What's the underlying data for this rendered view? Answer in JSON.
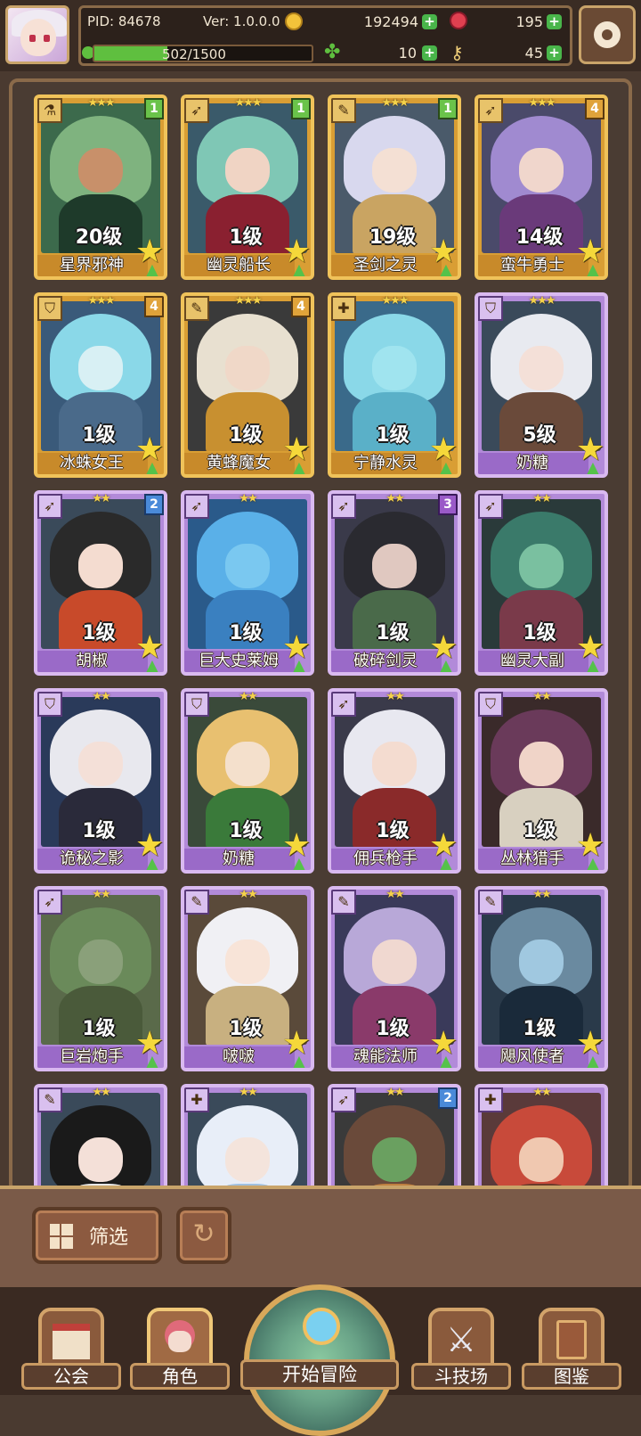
{
  "hud": {
    "pid": "PID: 84678",
    "version": "Ver: 1.0.0.0",
    "gold": "192494",
    "gems": "195",
    "stamina": "502/1500",
    "stamina_fraction": 0.335,
    "clover": "10",
    "key": "45",
    "colors": {
      "gold": "#f3c33a",
      "gem": "#e04050",
      "clover": "#5fbf3f",
      "key": "#f2d07a"
    }
  },
  "cards": [
    {
      "name": "星界邪神",
      "level": "20级",
      "rarity": "gold",
      "stars": "★★★",
      "badge": "1",
      "badge_color": "green",
      "role": "flask-icon",
      "palette": [
        "#3c6a4c",
        "#7fb37f",
        "#c8906a",
        "#1e3a2a"
      ]
    },
    {
      "name": "幽灵船长",
      "level": "1级",
      "rarity": "gold",
      "stars": "★★★",
      "badge": "1",
      "badge_color": "green",
      "role": "bow-icon",
      "palette": [
        "#3a5a6a",
        "#7fc7b5",
        "#f0d4c4",
        "#8a2030"
      ]
    },
    {
      "name": "圣剑之灵",
      "level": "19级",
      "rarity": "gold",
      "stars": "★★★",
      "badge": "1",
      "badge_color": "green",
      "role": "staff-icon",
      "palette": [
        "#4a5a6a",
        "#d8d8ee",
        "#f4e0d4",
        "#c9a462"
      ]
    },
    {
      "name": "蛮牛勇士",
      "level": "14级",
      "rarity": "gold",
      "stars": "★★★",
      "badge": "4",
      "badge_color": "gold",
      "role": "bow-icon",
      "palette": [
        "#4a4a6a",
        "#a08ad0",
        "#f0d6cc",
        "#6a3a7a"
      ]
    },
    {
      "name": "冰蛛女王",
      "level": "1级",
      "rarity": "gold",
      "stars": "★★★",
      "badge": "4",
      "badge_color": "gold",
      "role": "shield-icon",
      "palette": [
        "#3a5a7a",
        "#8ad8e8",
        "#d8f0f4",
        "#4a6a8a"
      ]
    },
    {
      "name": "黄蜂魔女",
      "level": "1级",
      "rarity": "gold",
      "stars": "★★★",
      "badge": "4",
      "badge_color": "gold",
      "role": "staff-icon",
      "palette": [
        "#3a3a3a",
        "#e8e0d0",
        "#f0d8c8",
        "#c89030"
      ]
    },
    {
      "name": "宁静水灵",
      "level": "1级",
      "rarity": "gold",
      "stars": "★★★",
      "badge": "",
      "badge_color": "",
      "role": "cross-icon",
      "palette": [
        "#3a6a8a",
        "#8ad8e8",
        "#a0e4ef",
        "#5ab0c8"
      ]
    },
    {
      "name": "奶糖",
      "level": "5级",
      "rarity": "purple",
      "stars": "★★★",
      "badge": "",
      "badge_color": "",
      "role": "shield-icon",
      "palette": [
        "#3a4a5a",
        "#e8eaf0",
        "#f4e0d8",
        "#6a4a3a"
      ]
    },
    {
      "name": "胡椒",
      "level": "1级",
      "rarity": "purple",
      "stars": "★★",
      "badge": "2",
      "badge_color": "blue",
      "role": "bow-icon",
      "palette": [
        "#3a4a5a",
        "#2a2a2a",
        "#f4dcd0",
        "#c84a2a"
      ]
    },
    {
      "name": "巨大史莱姆",
      "level": "1级",
      "rarity": "purple",
      "stars": "★★",
      "badge": "",
      "badge_color": "",
      "role": "bow-icon",
      "palette": [
        "#2a5a8a",
        "#5ab0e8",
        "#7ac8f0",
        "#3a80c0"
      ]
    },
    {
      "name": "破碎剑灵",
      "level": "1级",
      "rarity": "purple",
      "stars": "★★",
      "badge": "3",
      "badge_color": "purple",
      "role": "bow-icon",
      "palette": [
        "#3a3a4a",
        "#2a2a30",
        "#e0c8c0",
        "#4a6a4a"
      ]
    },
    {
      "name": "幽灵大副",
      "level": "1级",
      "rarity": "purple",
      "stars": "★★",
      "badge": "",
      "badge_color": "",
      "role": "bow-icon",
      "palette": [
        "#2a3a3a",
        "#3a7a6a",
        "#7ac0a0",
        "#7a3a4a"
      ]
    },
    {
      "name": "诡秘之影",
      "level": "1级",
      "rarity": "purple",
      "stars": "★★",
      "badge": "",
      "badge_color": "",
      "role": "shield-icon",
      "palette": [
        "#2a3a5a",
        "#e8e8ee",
        "#f4e0d8",
        "#2a2a3a"
      ]
    },
    {
      "name": "奶糖",
      "level": "1级",
      "rarity": "purple",
      "stars": "★★",
      "badge": "",
      "badge_color": "",
      "role": "shield-icon",
      "palette": [
        "#3a4a3a",
        "#e8c070",
        "#f4e0cc",
        "#3a7a3a"
      ]
    },
    {
      "name": "佣兵枪手",
      "level": "1级",
      "rarity": "purple",
      "stars": "★★",
      "badge": "",
      "badge_color": "",
      "role": "bow-icon",
      "palette": [
        "#3a3a4a",
        "#e8e8f0",
        "#f4dcd0",
        "#8a2a2a"
      ]
    },
    {
      "name": "丛林猎手",
      "level": "1级",
      "rarity": "purple",
      "stars": "★★",
      "badge": "",
      "badge_color": "",
      "role": "shield-icon",
      "palette": [
        "#3a2a2a",
        "#6a3a5a",
        "#f0d4c8",
        "#d8d0c0"
      ]
    },
    {
      "name": "巨岩炮手",
      "level": "1级",
      "rarity": "purple",
      "stars": "★★",
      "badge": "",
      "badge_color": "",
      "role": "bow-icon",
      "palette": [
        "#5a6a4a",
        "#6a8a5a",
        "#8aa07a",
        "#4a5a3a"
      ]
    },
    {
      "name": "啵啵",
      "level": "1级",
      "rarity": "purple",
      "stars": "★★",
      "badge": "",
      "badge_color": "",
      "role": "staff-icon",
      "palette": [
        "#5a4a3a",
        "#f0f0f4",
        "#f8e4d8",
        "#c8b080"
      ]
    },
    {
      "name": "魂能法师",
      "level": "1级",
      "rarity": "purple",
      "stars": "★★",
      "badge": "",
      "badge_color": "",
      "role": "staff-icon",
      "palette": [
        "#3a3a5a",
        "#b8a8d8",
        "#f0d8d0",
        "#8a3a6a"
      ]
    },
    {
      "name": "飓风使者",
      "level": "1级",
      "rarity": "purple",
      "stars": "★★",
      "badge": "",
      "badge_color": "",
      "role": "staff-icon",
      "palette": [
        "#2a3a4a",
        "#6a8aa0",
        "#a0c8e0",
        "#1a2a3a"
      ]
    },
    {
      "name": "",
      "level": "",
      "rarity": "purple",
      "stars": "★★",
      "badge": "",
      "badge_color": "",
      "role": "staff-icon",
      "palette": [
        "#3a4a5a",
        "#1a1a1a",
        "#f4e0d8",
        "#e8e8e8"
      ]
    },
    {
      "name": "",
      "level": "",
      "rarity": "purple",
      "stars": "★★",
      "badge": "",
      "badge_color": "",
      "role": "cross-icon",
      "palette": [
        "#3a4a5a",
        "#e8eef8",
        "#f4e4dc",
        "#a0c0e0"
      ]
    },
    {
      "name": "",
      "level": "",
      "rarity": "purple",
      "stars": "★★",
      "badge": "2",
      "badge_color": "blue",
      "role": "bow-icon",
      "palette": [
        "#3a3a3a",
        "#6a4a3a",
        "#6aa060",
        "#c08040"
      ]
    },
    {
      "name": "",
      "level": "",
      "rarity": "purple",
      "stars": "★★",
      "badge": "",
      "badge_color": "",
      "role": "cross-icon",
      "palette": [
        "#5a3a3a",
        "#c84a3a",
        "#f0c8b0",
        "#6a3a2a"
      ]
    }
  ],
  "filter": {
    "label": "筛选"
  },
  "nav": {
    "items": [
      {
        "label": "公会",
        "icon": "guild-icon"
      },
      {
        "label": "角色",
        "icon": "character-icon"
      },
      {
        "label": "开始冒险",
        "icon": "adventure-icon"
      },
      {
        "label": "斗技场",
        "icon": "arena-icon"
      },
      {
        "label": "图鉴",
        "icon": "codex-icon"
      }
    ]
  }
}
